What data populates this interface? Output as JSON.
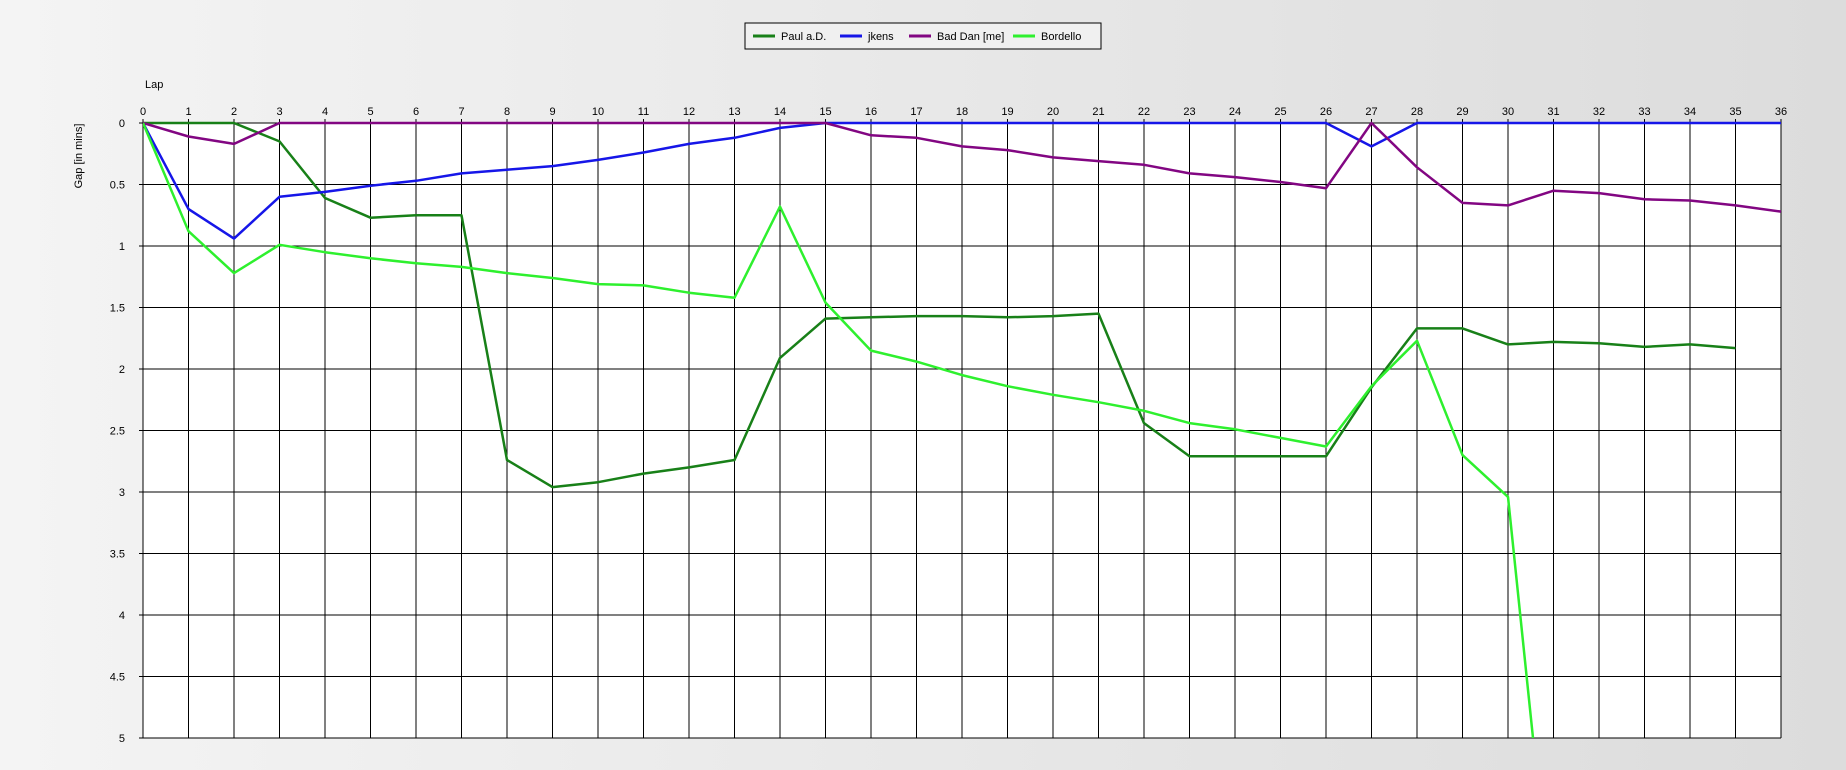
{
  "chart_data": {
    "type": "line",
    "title": "",
    "xlabel": "Lap",
    "ylabel": "Gap [in mins]",
    "xlim": [
      0,
      36
    ],
    "ylim": [
      0,
      5
    ],
    "y_inverted": true,
    "x_ticks": [
      0,
      1,
      2,
      3,
      4,
      5,
      6,
      7,
      8,
      9,
      10,
      11,
      12,
      13,
      14,
      15,
      16,
      17,
      18,
      19,
      20,
      21,
      22,
      23,
      24,
      25,
      26,
      27,
      28,
      29,
      30,
      31,
      32,
      33,
      34,
      35,
      36
    ],
    "y_ticks": [
      0,
      0.5,
      1,
      1.5,
      2,
      2.5,
      3,
      3.5,
      4,
      4.5,
      5
    ],
    "y_tick_labels": [
      "0",
      "0.5",
      "1",
      "1.5",
      "2",
      "2.5",
      "3",
      "3.5",
      "4",
      "4.5",
      "5"
    ],
    "grid": true,
    "legend": "top-center",
    "series": [
      {
        "name": "Paul a.D.",
        "color": "#188018",
        "points": [
          [
            0,
            0
          ],
          [
            1,
            0
          ],
          [
            2,
            0
          ],
          [
            3,
            0.15
          ],
          [
            4,
            0.61
          ],
          [
            5,
            0.77
          ],
          [
            6,
            0.75
          ],
          [
            7,
            0.75
          ],
          [
            8,
            2.74
          ],
          [
            9,
            2.96
          ],
          [
            10,
            2.92
          ],
          [
            11,
            2.85
          ],
          [
            12,
            2.8
          ],
          [
            13,
            2.74
          ],
          [
            14,
            1.91
          ],
          [
            15,
            1.59
          ],
          [
            16,
            1.58
          ],
          [
            17,
            1.57
          ],
          [
            18,
            1.57
          ],
          [
            19,
            1.58
          ],
          [
            20,
            1.57
          ],
          [
            21,
            1.55
          ],
          [
            22,
            2.44
          ],
          [
            23,
            2.71
          ],
          [
            24,
            2.71
          ],
          [
            25,
            2.71
          ],
          [
            26,
            2.71
          ],
          [
            27,
            2.15
          ],
          [
            28,
            1.67
          ],
          [
            29,
            1.67
          ],
          [
            30,
            1.8
          ],
          [
            31,
            1.78
          ],
          [
            32,
            1.79
          ],
          [
            33,
            1.82
          ],
          [
            34,
            1.8
          ],
          [
            35,
            1.83
          ]
        ]
      },
      {
        "name": "jkens",
        "color": "#1616e8",
        "points": [
          [
            0,
            0
          ],
          [
            1,
            0.7
          ],
          [
            2,
            0.94
          ],
          [
            3,
            0.6
          ],
          [
            4,
            0.56
          ],
          [
            5,
            0.51
          ],
          [
            6,
            0.47
          ],
          [
            7,
            0.41
          ],
          [
            8,
            0.38
          ],
          [
            9,
            0.35
          ],
          [
            10,
            0.3
          ],
          [
            11,
            0.24
          ],
          [
            12,
            0.17
          ],
          [
            13,
            0.12
          ],
          [
            14,
            0.04
          ],
          [
            15,
            0
          ],
          [
            16,
            0
          ],
          [
            17,
            0
          ],
          [
            18,
            0
          ],
          [
            19,
            0
          ],
          [
            20,
            0
          ],
          [
            21,
            0
          ],
          [
            22,
            0
          ],
          [
            23,
            0
          ],
          [
            24,
            0
          ],
          [
            25,
            0
          ],
          [
            26,
            0
          ],
          [
            27,
            0.19
          ],
          [
            28,
            0
          ],
          [
            29,
            0
          ],
          [
            30,
            0
          ],
          [
            31,
            0
          ],
          [
            32,
            0
          ],
          [
            33,
            0
          ],
          [
            34,
            0
          ],
          [
            35,
            0
          ],
          [
            36,
            0
          ]
        ]
      },
      {
        "name": "Bad Dan [me]",
        "color": "#820682",
        "points": [
          [
            0,
            0
          ],
          [
            1,
            0.11
          ],
          [
            2,
            0.17
          ],
          [
            3,
            0
          ],
          [
            4,
            0
          ],
          [
            5,
            0
          ],
          [
            6,
            0
          ],
          [
            7,
            0
          ],
          [
            8,
            0
          ],
          [
            9,
            0
          ],
          [
            10,
            0
          ],
          [
            11,
            0
          ],
          [
            12,
            0
          ],
          [
            13,
            0
          ],
          [
            14,
            0
          ],
          [
            15,
            0
          ],
          [
            16,
            0.1
          ],
          [
            17,
            0.12
          ],
          [
            18,
            0.19
          ],
          [
            19,
            0.22
          ],
          [
            20,
            0.28
          ],
          [
            21,
            0.31
          ],
          [
            22,
            0.34
          ],
          [
            23,
            0.41
          ],
          [
            24,
            0.44
          ],
          [
            25,
            0.48
          ],
          [
            26,
            0.53
          ],
          [
            27,
            0
          ],
          [
            28,
            0.36
          ],
          [
            29,
            0.65
          ],
          [
            30,
            0.67
          ],
          [
            31,
            0.55
          ],
          [
            32,
            0.57
          ],
          [
            33,
            0.62
          ],
          [
            34,
            0.63
          ],
          [
            35,
            0.67
          ],
          [
            36,
            0.72
          ]
        ]
      },
      {
        "name": "Bordello",
        "color": "#2ef02e",
        "points": [
          [
            0,
            0
          ],
          [
            1,
            0.88
          ],
          [
            2,
            1.22
          ],
          [
            3,
            0.99
          ],
          [
            4,
            1.05
          ],
          [
            5,
            1.1
          ],
          [
            6,
            1.14
          ],
          [
            7,
            1.17
          ],
          [
            8,
            1.22
          ],
          [
            9,
            1.26
          ],
          [
            10,
            1.31
          ],
          [
            11,
            1.32
          ],
          [
            12,
            1.38
          ],
          [
            13,
            1.42
          ],
          [
            14,
            0.68
          ],
          [
            15,
            1.46
          ],
          [
            16,
            1.85
          ],
          [
            17,
            1.94
          ],
          [
            18,
            2.05
          ],
          [
            19,
            2.14
          ],
          [
            20,
            2.21
          ],
          [
            21,
            2.27
          ],
          [
            22,
            2.34
          ],
          [
            23,
            2.44
          ],
          [
            24,
            2.49
          ],
          [
            25,
            2.56
          ],
          [
            26,
            2.63
          ],
          [
            27,
            2.14
          ],
          [
            28,
            1.77
          ],
          [
            29,
            2.7
          ],
          [
            30,
            3.04
          ],
          [
            30.55,
            5.0
          ]
        ]
      }
    ]
  }
}
